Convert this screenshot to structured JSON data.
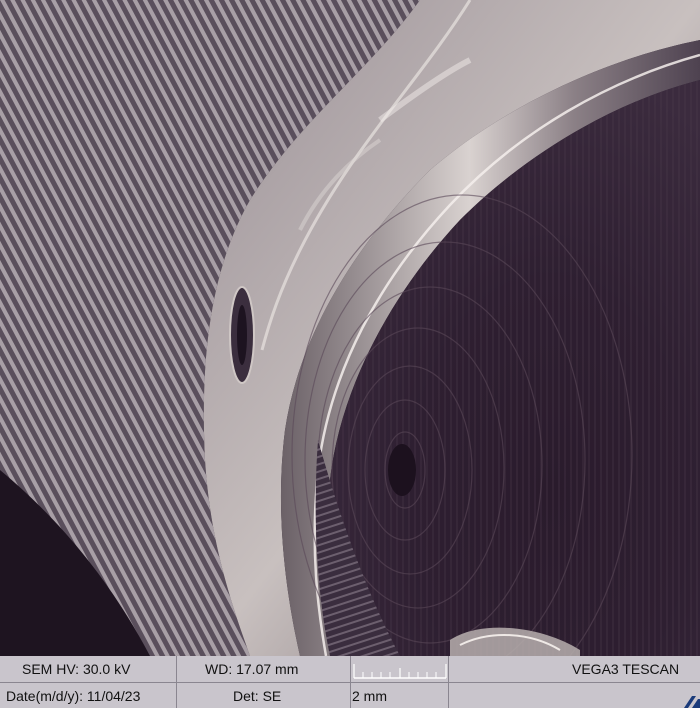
{
  "databar": {
    "hv_label": "SEM HV:",
    "hv_value": "30.0 kV",
    "wd_label": "WD:",
    "wd_value": "17.07 mm",
    "brand": "VEGA3 TESCAN",
    "date_label": "Date(m/d/y):",
    "date_value": "11/04/23",
    "det_label": "Det:",
    "det_value": "SE",
    "scale_value": "2 mm"
  },
  "colors": {
    "background_dark": "#221626",
    "surface_light": "#b9b0b4",
    "databar": "#c9c5cc"
  }
}
